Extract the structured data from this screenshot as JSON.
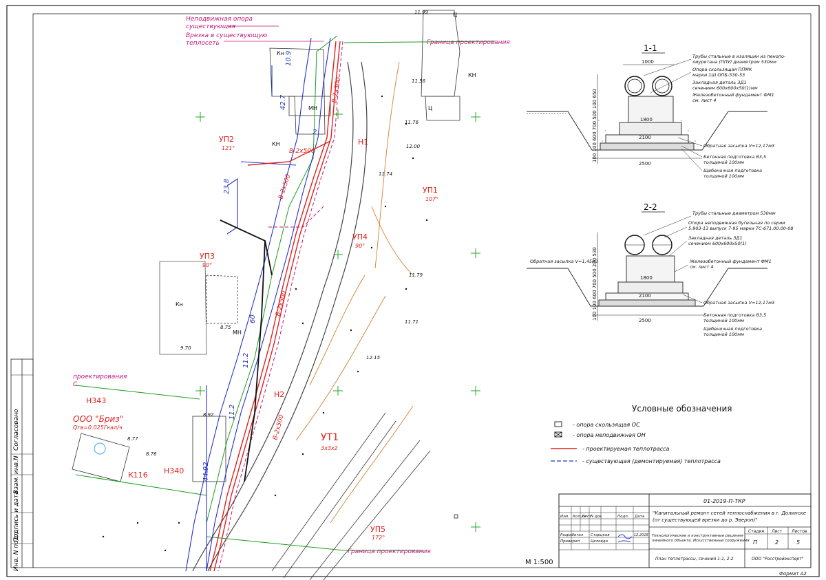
{
  "binding": {
    "agreed": "Согласовано",
    "replaced": "Взам. инв.N",
    "signature": "Подпись и дата",
    "original": "Инв. N подл."
  },
  "plan": {
    "scale": "М 1:500",
    "pipe_spec": "В-2х500",
    "dimensions": [
      "10.9",
      "42.7",
      "23.8",
      "60",
      "44.92",
      "11.2",
      "2",
      "11.2"
    ],
    "elevations": [
      "11.99",
      "11.56",
      "11.76",
      "12.00",
      "11.74",
      "11.79",
      "11.71",
      "12.15",
      "8.92",
      "8.77",
      "8.76",
      "8.75",
      "9.70"
    ],
    "labels": {
      "kn1": "Кн",
      "kn2": "КН",
      "mn1": "МН",
      "mn2": "МН",
      "kn3": "КН",
      "kn4": "Кн",
      "c1": "Ц",
      "c2": "Ц"
    },
    "nodes": {
      "up2": {
        "name": "УП2",
        "angle": "121°"
      },
      "n1": {
        "name": "Н1"
      },
      "up1": {
        "name": "УП1",
        "angle": "107°"
      },
      "up4": {
        "name": "УП4",
        "angle": "90°"
      },
      "up3": {
        "name": "УП3",
        "angle": "90°"
      },
      "n2": {
        "name": "Н2"
      },
      "ut1": {
        "name": "УТ1",
        "size": "3х3х2"
      },
      "n343": {
        "name": "Н343"
      },
      "k116": {
        "name": "К116"
      },
      "n340": {
        "name": "Н340"
      },
      "up5": {
        "name": "УП5",
        "angle": "172°"
      }
    },
    "consumer": {
      "name": "ООО \"Бриз\"",
      "load": "Qгв=0.025Гкал/ч"
    },
    "annotations": {
      "fixed_support_1": "Неподвижная опора",
      "fixed_support_2": "существующая",
      "tie_in_1": "Врезка в существующую",
      "tie_in_2": "теплосеть",
      "design_boundary": "Граница проектирования",
      "design_cut_1": "проектирования",
      "design_cut_2": "С"
    }
  },
  "section1": {
    "title": "1-1",
    "dim_top": "1000",
    "dim_bottom": "2500",
    "dim_mid": "2100",
    "dim_found": "1800",
    "dim_vertical": "100 100 600 700 500 100 650",
    "callouts": [
      "Трубы стальные в изоляции из пенопо-",
      "лиуретана (ППУ) диаметром 530мм",
      "Опора скользящая ППМК",
      "марки 1Ш.ОПБ-530-53",
      "Закладная деталь ЗД1",
      "сечением 600х600х50(1)мм",
      "Железобетонный фундамент ФМ1",
      "см. лист 4",
      "Обратная засыпка V=12,17м3",
      "Бетонная подготовка В3,5",
      "толщиной 100мм",
      "Щебеночная подготовка",
      "толщиной 100мм"
    ]
  },
  "section2": {
    "title": "2-2",
    "dim_bottom": "2500",
    "dim_mid": "2100",
    "dim_found": "1800",
    "dim_vertical": "100 100 600 700 500 200 530",
    "callouts": [
      "Трубы стальные диаметром 530мм",
      "Опора неподвижная бугельная по серии",
      "5.903-13 выпуск 7-95 марки ТС-671.00.00-08",
      "Закладная деталь ЗД1",
      "сечением 600х600х50(1)",
      "Железобетонный фундамент ФМ1",
      "см. лист 4",
      "Обратная засыпка V=1,45м3",
      "Обратная засыпка V=12,17м3",
      "Бетонная подготовка В3,5",
      "толщиной 100мм",
      "Щебеночная подготовка",
      "толщиной 100мм"
    ]
  },
  "legend": {
    "title": "Условные обозначения",
    "items": [
      "- опора скользящая ОС",
      "- опора неподвижная ОН",
      "- проектируемая теплотрасса",
      "- существующая (демонтируемая) теплотрасса"
    ]
  },
  "title_block": {
    "doc_code": "01-2019-П-ТКР",
    "project_title_1": "\"Капитальный ремонт сетей теплоснабжения в г. Долинске",
    "project_title_2": "(от существующей врезки до р. Эверон)\"",
    "section_1": "Технологические и конструктивные решения",
    "section_2": "линейного объекта. Искусственные сооружения",
    "section_3": "",
    "sheet_title": "План теплотрассы, сечения 1-1, 2-2",
    "company": "ООО \"Росстройэксперт\"",
    "col_stage": "Стадия",
    "col_sheet": "Лист",
    "col_sheets": "Листов",
    "stage": "П",
    "sheet": "2",
    "sheets": "5",
    "headers": [
      "Изм.",
      "Кол.уч",
      "Лист",
      "N док.",
      "Подп.",
      "Дата"
    ],
    "roles": [
      "Разработал",
      "Проверил"
    ],
    "people": [
      "Старцков",
      "Целовда"
    ],
    "date": "12.2019",
    "format": "Формат А2"
  }
}
